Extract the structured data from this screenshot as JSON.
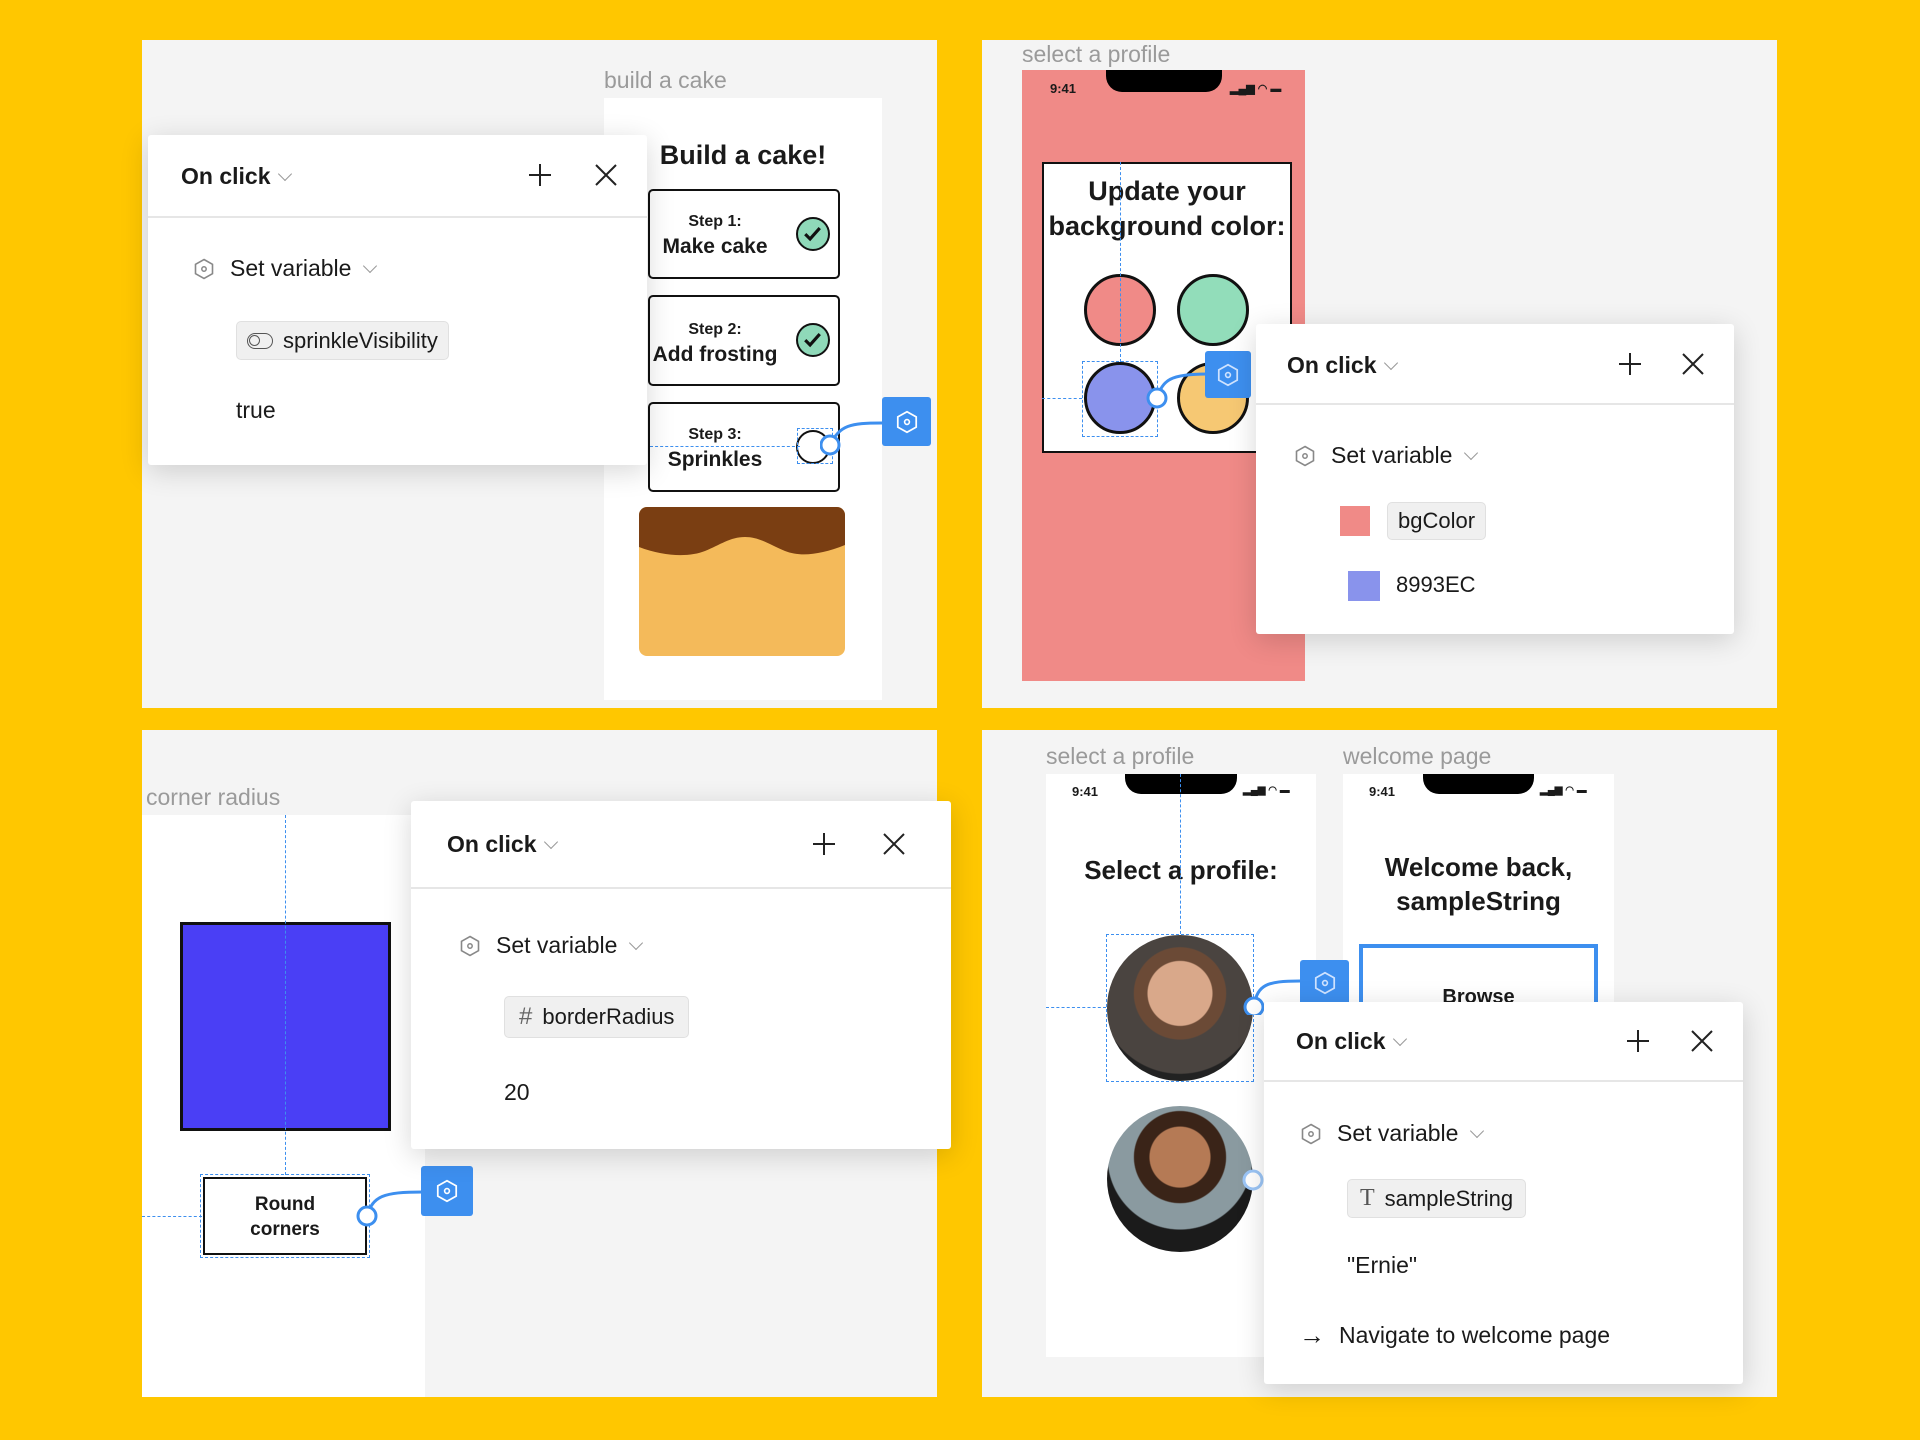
{
  "colors": {
    "background": "#FFC700",
    "accent": "#3D8FEF",
    "pink": "#F08A87",
    "blue_square": "#4A3FF5",
    "swatch_bg": "#F08A87",
    "swatch_value": "#8993EC"
  },
  "q1": {
    "frame_label": "build a cake",
    "title": "Build a cake!",
    "steps": [
      {
        "num": "Step 1:",
        "name": "Make cake",
        "done": true
      },
      {
        "num": "Step 2:",
        "name": "Add frosting",
        "done": true
      },
      {
        "num": "Step 3:",
        "name": "Sprinkles",
        "done": false
      }
    ],
    "popup": {
      "trigger": "On click",
      "action": "Set variable",
      "variable": "sprinkleVisibility",
      "variable_icon": "toggle-icon",
      "value": "true"
    }
  },
  "q2": {
    "frame_label": "select a profile",
    "time": "9:41",
    "card_title_1": "Update your",
    "card_title_2": "background color:",
    "popup": {
      "trigger": "On click",
      "action": "Set variable",
      "variable": "bgColor",
      "value": "8993EC"
    }
  },
  "q3": {
    "frame_label": "corner radius",
    "button_1": "Round",
    "button_2": "corners",
    "popup": {
      "trigger": "On click",
      "action": "Set variable",
      "variable": "borderRadius",
      "variable_icon": "hash-icon",
      "value": "20"
    }
  },
  "q4": {
    "frame_label_1": "select a profile",
    "frame_label_2": "welcome page",
    "time": "9:41",
    "select_title": "Select a profile:",
    "welcome_1": "Welcome back,",
    "welcome_2": "sampleString",
    "browse": "Browse",
    "popup": {
      "trigger": "On click",
      "action": "Set variable",
      "variable": "sampleString",
      "variable_icon": "text-icon",
      "value": "\"Ernie\"",
      "navigate": "Navigate to welcome page"
    }
  }
}
